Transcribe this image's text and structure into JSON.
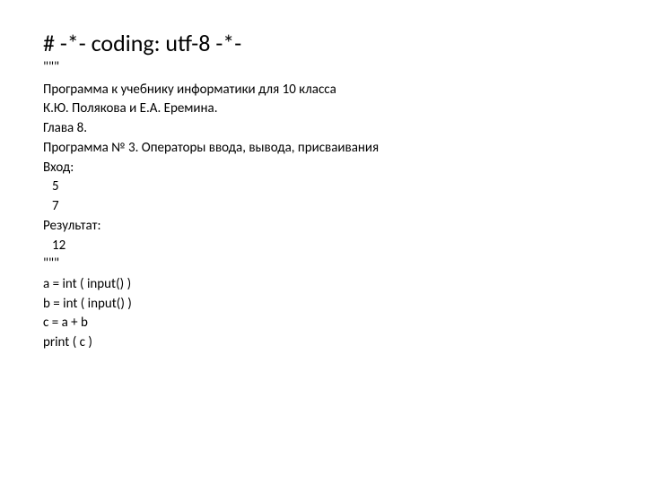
{
  "heading": "# -*- coding: utf-8 -*-",
  "triple_quote_open": "\"\"\"",
  "doc": {
    "line1": "Программа к учебнику информатики для 10 класса",
    "line2": "К.Ю. Полякова и Е.А. Еремина.",
    "line3": "Глава 8.",
    "line4": "Программа № 3. Операторы ввода, вывода, присваивания",
    "line5": "Вход:",
    "input1": "5",
    "input2": "7",
    "line6": "Результат:",
    "output1": "12"
  },
  "triple_quote_close": "\"\"\"",
  "code": {
    "line1": "a = int ( input() )",
    "line2": "b = int ( input() )",
    "line3": "c = a + b",
    "line4": "print ( c )"
  }
}
